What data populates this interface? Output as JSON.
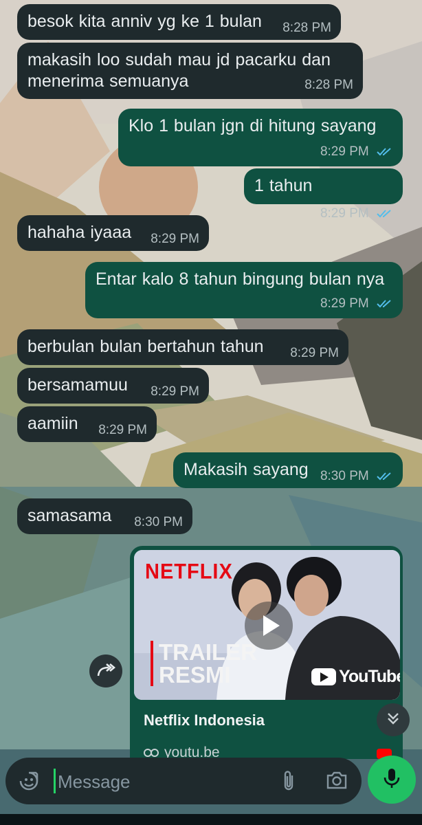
{
  "messages": [
    {
      "dir": "in",
      "text": "besok kita anniv yg ke 1 bulan",
      "time": "8:28 PM"
    },
    {
      "dir": "in",
      "text": "makasih loo sudah mau jd pacarku dan menerima semuanya",
      "time": "8:28 PM"
    },
    {
      "dir": "out",
      "text": "Klo 1 bulan jgn di hitung sayang",
      "time": "8:29 PM",
      "status": "read"
    },
    {
      "dir": "out",
      "text": "1 tahun",
      "time": "8:29 PM",
      "status": "read"
    },
    {
      "dir": "in",
      "text": "hahaha iyaaa",
      "time": "8:29 PM"
    },
    {
      "dir": "out",
      "text": "Entar kalo 8 tahun bingung bulan nya",
      "time": "8:29 PM",
      "status": "read"
    },
    {
      "dir": "in",
      "text": "berbulan bulan bertahun tahun",
      "time": "8:29 PM"
    },
    {
      "dir": "in",
      "text": "bersamamuu",
      "time": "8:29 PM"
    },
    {
      "dir": "in",
      "text": "aamiin",
      "time": "8:29 PM"
    },
    {
      "dir": "out",
      "text": "Makasih sayang",
      "time": "8:30 PM",
      "status": "read"
    },
    {
      "dir": "in",
      "text": "samasama",
      "time": "8:30 PM"
    }
  ],
  "link_preview": {
    "brand": "NETFLIX",
    "trailer_line1": "TRAILER",
    "trailer_line2": "RESMI",
    "youtube_label": "YouTube",
    "title": "Netflix Indonesia",
    "url": "youtu.be"
  },
  "composer": {
    "placeholder": "Message"
  },
  "icons": {
    "forward": "forward-icon",
    "scroll_down": "double-chevron-down-icon",
    "emoji": "sticker-icon",
    "attach": "paperclip-icon",
    "camera": "camera-icon",
    "mic": "mic-icon",
    "read": "double-check-icon"
  },
  "colors": {
    "incoming_bubble": "#1f2a2d",
    "outgoing_bubble": "#0f5141",
    "read_tick": "#53bdeb",
    "accent": "#21c063",
    "netflix_red": "#e50914"
  }
}
